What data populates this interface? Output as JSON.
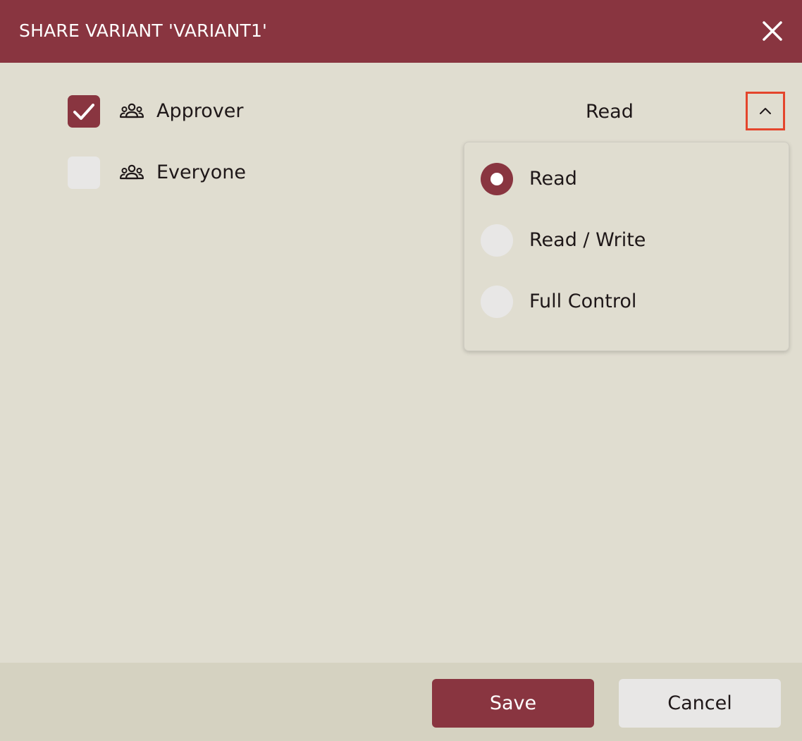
{
  "dialog": {
    "title": "SHARE VARIANT 'VARIANT1'",
    "close_icon": "close-icon"
  },
  "share_list": [
    {
      "label": "Approver",
      "checked": true,
      "icon": "group-icon",
      "permission": "Read"
    },
    {
      "label": "Everyone",
      "checked": false,
      "icon": "group-icon"
    }
  ],
  "permission_dropdown": {
    "expanded": true,
    "toggle_icon": "chevron-up-icon",
    "selected": "Read",
    "options": [
      {
        "label": "Read",
        "selected": true
      },
      {
        "label": "Read / Write",
        "selected": false
      },
      {
        "label": "Full Control",
        "selected": false
      }
    ]
  },
  "footer": {
    "save_label": "Save",
    "cancel_label": "Cancel"
  },
  "colors": {
    "accent": "#893540",
    "background": "#e0ddd0",
    "footer_background": "#d5d2c1",
    "control_background": "#e8e7e6",
    "highlight_border": "#e4452c"
  }
}
